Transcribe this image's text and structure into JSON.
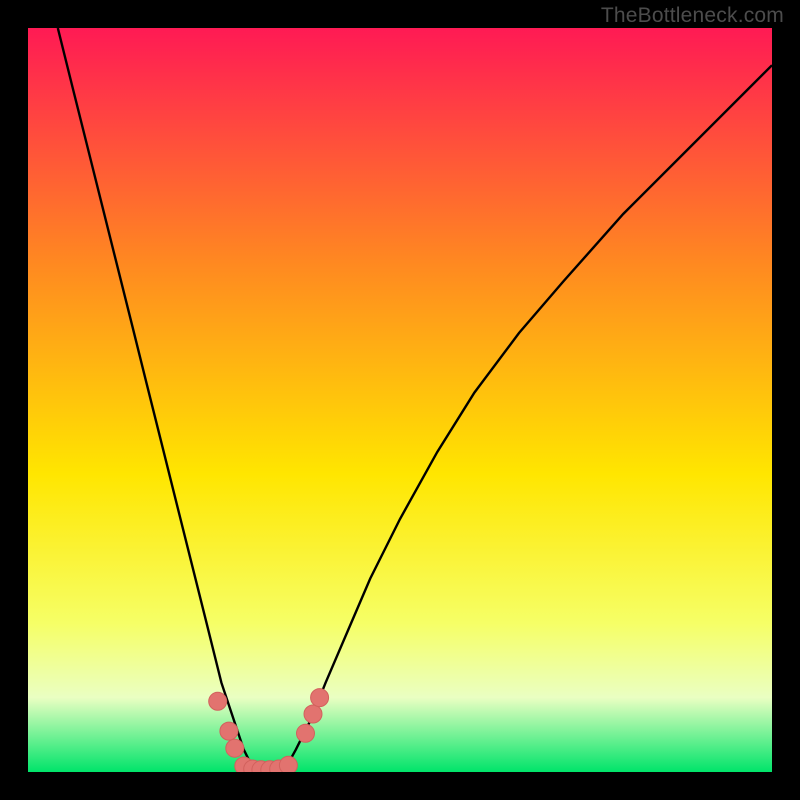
{
  "watermark": "TheBottleneck.com",
  "colors": {
    "gradient_top": "#ff1a54",
    "gradient_upper_mid": "#ff8a20",
    "gradient_mid": "#ffe600",
    "gradient_lower_mid": "#f6ff66",
    "gradient_band": "#eaffc2",
    "gradient_bottom": "#00e46a",
    "curve": "#000000",
    "marker_fill": "#e2736f",
    "marker_stroke": "#d2615d",
    "frame_bg": "#000000"
  },
  "chart_data": {
    "type": "line",
    "title": "",
    "xlabel": "",
    "ylabel": "",
    "xlim": [
      0,
      100
    ],
    "ylim": [
      0,
      100
    ],
    "curve": {
      "x": [
        4,
        6,
        8,
        10,
        12,
        14,
        16,
        18,
        20,
        22,
        24,
        26,
        28,
        29,
        30,
        31,
        32,
        33,
        34,
        35,
        36,
        38,
        40,
        43,
        46,
        50,
        55,
        60,
        66,
        72,
        80,
        88,
        96,
        100
      ],
      "y": [
        100,
        92,
        84,
        76,
        68,
        60,
        52,
        44,
        36,
        28,
        20,
        12,
        6,
        3,
        1,
        0,
        0,
        0,
        0.5,
        1.2,
        3,
        7,
        12,
        19,
        26,
        34,
        43,
        51,
        59,
        66,
        75,
        83,
        91,
        95
      ]
    },
    "markers": [
      {
        "x": 25.5,
        "y": 9.5
      },
      {
        "x": 27.0,
        "y": 5.5
      },
      {
        "x": 27.8,
        "y": 3.2
      },
      {
        "x": 29.0,
        "y": 0.8
      },
      {
        "x": 30.2,
        "y": 0.4
      },
      {
        "x": 31.3,
        "y": 0.3
      },
      {
        "x": 32.5,
        "y": 0.3
      },
      {
        "x": 33.7,
        "y": 0.4
      },
      {
        "x": 35.0,
        "y": 0.9
      },
      {
        "x": 37.3,
        "y": 5.2
      },
      {
        "x": 38.3,
        "y": 7.8
      },
      {
        "x": 39.2,
        "y": 10.0
      }
    ]
  }
}
